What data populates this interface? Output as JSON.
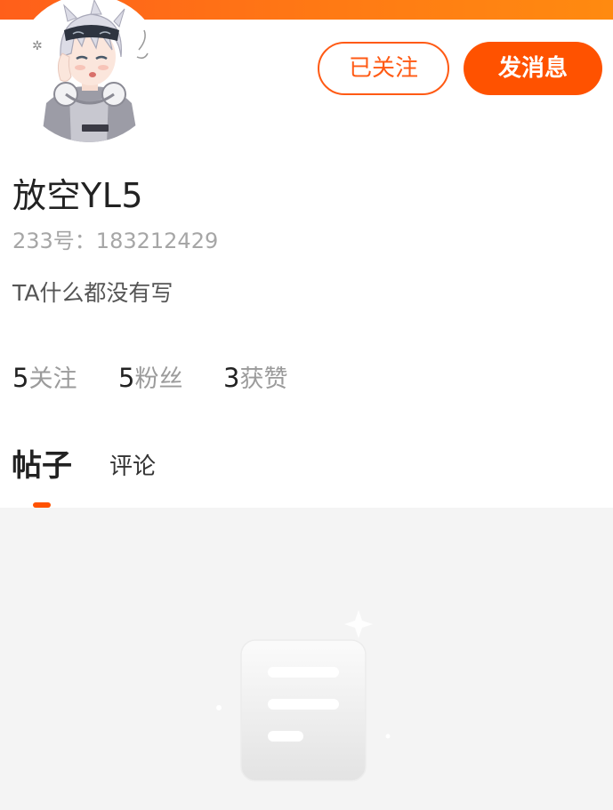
{
  "header": {
    "banner_color": "#ff6a14"
  },
  "profile": {
    "avatar_icon": "anime-avatar-icon",
    "username": "放空YL5",
    "uid_text": "233号：183212429",
    "bio": "TA什么都没有写"
  },
  "actions": {
    "follow_label": "已关注",
    "message_label": "发消息",
    "accent_color": "#ff5200"
  },
  "stats": {
    "following": {
      "value": "5",
      "label": "关注"
    },
    "followers": {
      "value": "5",
      "label": "粉丝"
    },
    "likes": {
      "value": "3",
      "label": "获赞"
    }
  },
  "tabs": [
    {
      "label": "帖子",
      "active": true
    },
    {
      "label": "评论",
      "active": false
    }
  ],
  "empty_state": {
    "icon": "empty-document-icon"
  }
}
